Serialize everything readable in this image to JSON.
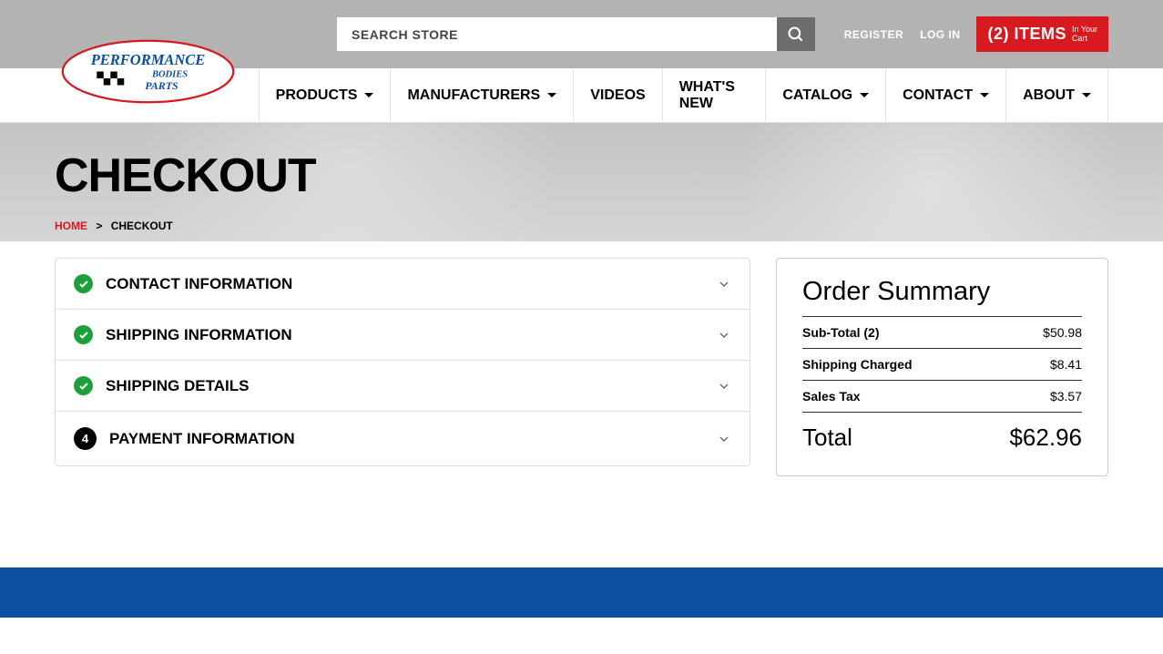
{
  "search": {
    "placeholder": "SEARCH STORE"
  },
  "toplinks": {
    "register": "REGISTER",
    "login": "LOG IN"
  },
  "cart": {
    "count_label": "(2) ITEMS",
    "sub1": "In Your",
    "sub2": "Cart"
  },
  "logo": {
    "line1": "PERFORMANCE",
    "line2": "BODIES",
    "line3": "PARTS"
  },
  "nav": {
    "products": "PRODUCTS",
    "manufacturers": "MANUFACTURERS",
    "videos": "VIDEOS",
    "whatsnew": "WHAT'S NEW",
    "catalog": "CATALOG",
    "contact": "CONTACT",
    "about": "ABOUT"
  },
  "hero": {
    "title": "CHECKOUT"
  },
  "crumbs": {
    "home": "HOME",
    "sep": ">",
    "current": "CHECKOUT"
  },
  "steps": {
    "s1": "CONTACT INFORMATION",
    "s2": "SHIPPING INFORMATION",
    "s3": "SHIPPING DETAILS",
    "s4_num": "4",
    "s4": "PAYMENT INFORMATION"
  },
  "summary": {
    "title": "Order Summary",
    "subtotal_lbl": "Sub-Total (2)",
    "subtotal_val": "$50.98",
    "shipping_lbl": "Shipping Charged",
    "shipping_val": "$8.41",
    "tax_lbl": "Sales Tax",
    "tax_val": "$3.57",
    "total_lbl": "Total",
    "total_val": "$62.96"
  }
}
